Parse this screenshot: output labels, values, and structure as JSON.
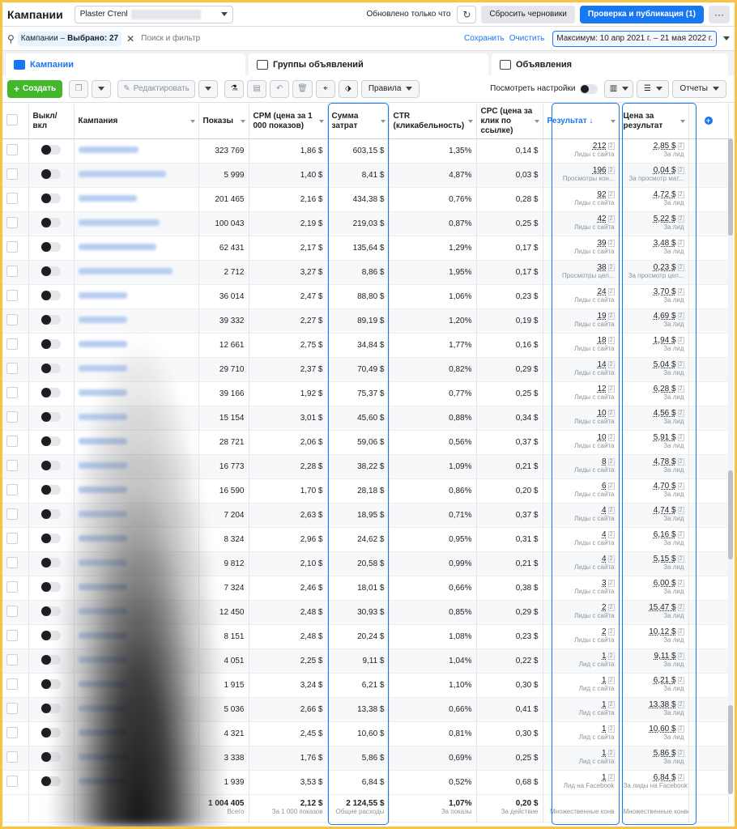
{
  "topbar": {
    "title": "Кампании",
    "account": "Plaster Стеnl",
    "updated": "Обновлено только что",
    "refresh_icon": "refresh-icon",
    "discard": "Сбросить черновики",
    "publish": "Проверка и публикация (1)",
    "more": "···"
  },
  "filter": {
    "chip_label": "Кампании",
    "chip_sep": "–",
    "chip_selected": "Выбрано: 27",
    "placeholder": "Поиск и фильтр",
    "save": "Сохранить",
    "clear": "Очистить",
    "date_range": "Максимум: 10 апр 2021 г. – 21 мая 2022 г."
  },
  "tabs": [
    {
      "label": "Кампании",
      "active": true
    },
    {
      "label": "Группы объявлений",
      "active": false
    },
    {
      "label": "Объявления",
      "active": false
    }
  ],
  "toolbar": {
    "create": "Создать",
    "edit": "Редактировать",
    "rules": "Правила",
    "view_settings": "Посмотреть настройки",
    "reports": "Отчеты"
  },
  "columns": {
    "onoff": "Выкл/вкл",
    "campaign": "Кампания",
    "impressions": "Показы",
    "cpm": "CPM (цена за 1 000 показов)",
    "spend": "Сумма затрат",
    "ctr": "CTR (кликабельность)",
    "cpc": "CPC (цена за клик по ссылке)",
    "result": "Результат ↓",
    "cost": "Цена за результат"
  },
  "rows": [
    {
      "imp": "323 769",
      "cpm": "1,86 $",
      "spend": "603,15 $",
      "ctr": "1,35%",
      "cpc": "0,14 $",
      "res": "212",
      "res_sub": "Лиды с сайта",
      "cost": "2,85 $",
      "cost_sub": "За лид",
      "bw": 74
    },
    {
      "imp": "5 999",
      "cpm": "1,40 $",
      "spend": "8,41 $",
      "ctr": "4,87%",
      "cpc": "0,03 $",
      "res": "196",
      "res_sub": "Просмотры кон...",
      "cost": "0,04 $",
      "cost_sub": "За просмотр мат...",
      "bw": 108
    },
    {
      "imp": "201 465",
      "cpm": "2,16 $",
      "spend": "434,38 $",
      "ctr": "0,76%",
      "cpc": "0,28 $",
      "res": "92",
      "res_sub": "Лиды с сайта",
      "cost": "4,72 $",
      "cost_sub": "За лид",
      "bw": 72
    },
    {
      "imp": "100 043",
      "cpm": "2,19 $",
      "spend": "219,03 $",
      "ctr": "0,87%",
      "cpc": "0,25 $",
      "res": "42",
      "res_sub": "Лиды с сайта",
      "cost": "5,22 $",
      "cost_sub": "За лид",
      "bw": 100
    },
    {
      "imp": "62 431",
      "cpm": "2,17 $",
      "spend": "135,64 $",
      "ctr": "1,29%",
      "cpc": "0,17 $",
      "res": "39",
      "res_sub": "Лиды с сайта",
      "cost": "3,48 $",
      "cost_sub": "За лид",
      "bw": 96
    },
    {
      "imp": "2 712",
      "cpm": "3,27 $",
      "spend": "8,86 $",
      "ctr": "1,95%",
      "cpc": "0,17 $",
      "res": "38",
      "res_sub": "Просмотры цел...",
      "cost": "0,23 $",
      "cost_sub": "За просмотр цел...",
      "bw": 116
    },
    {
      "imp": "36 014",
      "cpm": "2,47 $",
      "spend": "88,80 $",
      "ctr": "1,06%",
      "cpc": "0,23 $",
      "res": "24",
      "res_sub": "Лиды с сайта",
      "cost": "3,70 $",
      "cost_sub": "За лид",
      "bw": 60
    },
    {
      "imp": "39 332",
      "cpm": "2,27 $",
      "spend": "89,19 $",
      "ctr": "1,20%",
      "cpc": "0,19 $",
      "res": "19",
      "res_sub": "Лиды с сайта",
      "cost": "4,69 $",
      "cost_sub": "За лид",
      "bw": 60
    },
    {
      "imp": "12 661",
      "cpm": "2,75 $",
      "spend": "34,84 $",
      "ctr": "1,77%",
      "cpc": "0,16 $",
      "res": "18",
      "res_sub": "Лиды с сайта",
      "cost": "1,94 $",
      "cost_sub": "За лид",
      "bw": 60
    },
    {
      "imp": "29 710",
      "cpm": "2,37 $",
      "spend": "70,49 $",
      "ctr": "0,82%",
      "cpc": "0,29 $",
      "res": "14",
      "res_sub": "Лиды с сайта",
      "cost": "5,04 $",
      "cost_sub": "За лид",
      "bw": 60
    },
    {
      "imp": "39 166",
      "cpm": "1,92 $",
      "spend": "75,37 $",
      "ctr": "0,77%",
      "cpc": "0,25 $",
      "res": "12",
      "res_sub": "Лиды с сайта",
      "cost": "6,28 $",
      "cost_sub": "За лид",
      "bw": 60
    },
    {
      "imp": "15 154",
      "cpm": "3,01 $",
      "spend": "45,60 $",
      "ctr": "0,88%",
      "cpc": "0,34 $",
      "res": "10",
      "res_sub": "Лиды с сайта",
      "cost": "4,56 $",
      "cost_sub": "За лид",
      "bw": 60
    },
    {
      "imp": "28 721",
      "cpm": "2,06 $",
      "spend": "59,06 $",
      "ctr": "0,56%",
      "cpc": "0,37 $",
      "res": "10",
      "res_sub": "Лиды с сайта",
      "cost": "5,91 $",
      "cost_sub": "За лид",
      "bw": 60
    },
    {
      "imp": "16 773",
      "cpm": "2,28 $",
      "spend": "38,22 $",
      "ctr": "1,09%",
      "cpc": "0,21 $",
      "res": "8",
      "res_sub": "Лиды с сайта",
      "cost": "4,78 $",
      "cost_sub": "За лид",
      "bw": 60
    },
    {
      "imp": "16 590",
      "cpm": "1,70 $",
      "spend": "28,18 $",
      "ctr": "0,86%",
      "cpc": "0,20 $",
      "res": "6",
      "res_sub": "Лиды с сайта",
      "cost": "4,70 $",
      "cost_sub": "За лид",
      "bw": 60
    },
    {
      "imp": "7 204",
      "cpm": "2,63 $",
      "spend": "18,95 $",
      "ctr": "0,71%",
      "cpc": "0,37 $",
      "res": "4",
      "res_sub": "Лиды с сайта",
      "cost": "4,74 $",
      "cost_sub": "За лид",
      "bw": 60
    },
    {
      "imp": "8 324",
      "cpm": "2,96 $",
      "spend": "24,62 $",
      "ctr": "0,95%",
      "cpc": "0,31 $",
      "res": "4",
      "res_sub": "Лиды с сайта",
      "cost": "6,16 $",
      "cost_sub": "За лид",
      "bw": 60
    },
    {
      "imp": "9 812",
      "cpm": "2,10 $",
      "spend": "20,58 $",
      "ctr": "0,99%",
      "cpc": "0,21 $",
      "res": "4",
      "res_sub": "Лиды с сайта",
      "cost": "5,15 $",
      "cost_sub": "За лид",
      "bw": 60
    },
    {
      "imp": "7 324",
      "cpm": "2,46 $",
      "spend": "18,01 $",
      "ctr": "0,66%",
      "cpc": "0,38 $",
      "res": "3",
      "res_sub": "Лиды с сайта",
      "cost": "6,00 $",
      "cost_sub": "За лид",
      "bw": 60
    },
    {
      "imp": "12 450",
      "cpm": "2,48 $",
      "spend": "30,93 $",
      "ctr": "0,85%",
      "cpc": "0,29 $",
      "res": "2",
      "res_sub": "Лиды с сайта",
      "cost": "15,47 $",
      "cost_sub": "За лид",
      "bw": 60
    },
    {
      "imp": "8 151",
      "cpm": "2,48 $",
      "spend": "20,24 $",
      "ctr": "1,08%",
      "cpc": "0,23 $",
      "res": "2",
      "res_sub": "Лиды с сайта",
      "cost": "10,12 $",
      "cost_sub": "За лид",
      "bw": 60
    },
    {
      "imp": "4 051",
      "cpm": "2,25 $",
      "spend": "9,11 $",
      "ctr": "1,04%",
      "cpc": "0,22 $",
      "res": "1",
      "res_sub": "Лид с сайта",
      "cost": "9,11 $",
      "cost_sub": "За лид",
      "bw": 60
    },
    {
      "imp": "1 915",
      "cpm": "3,24 $",
      "spend": "6,21 $",
      "ctr": "1,10%",
      "cpc": "0,30 $",
      "res": "1",
      "res_sub": "Лид с сайта",
      "cost": "6,21 $",
      "cost_sub": "За лид",
      "bw": 60
    },
    {
      "imp": "5 036",
      "cpm": "2,66 $",
      "spend": "13,38 $",
      "ctr": "0,66%",
      "cpc": "0,41 $",
      "res": "1",
      "res_sub": "Лид с сайта",
      "cost": "13,38 $",
      "cost_sub": "За лид",
      "bw": 60
    },
    {
      "imp": "4 321",
      "cpm": "2,45 $",
      "spend": "10,60 $",
      "ctr": "0,81%",
      "cpc": "0,30 $",
      "res": "1",
      "res_sub": "Лид с сайта",
      "cost": "10,60 $",
      "cost_sub": "За лид",
      "bw": 60
    },
    {
      "imp": "3 338",
      "cpm": "1,76 $",
      "spend": "5,86 $",
      "ctr": "0,69%",
      "cpc": "0,25 $",
      "res": "1",
      "res_sub": "Лид с сайта",
      "cost": "5,86 $",
      "cost_sub": "За лид",
      "bw": 60
    },
    {
      "imp": "1 939",
      "cpm": "3,53 $",
      "spend": "6,84 $",
      "ctr": "0,52%",
      "cpc": "0,68 $",
      "res": "1",
      "res_sub": "Лид на Facebook",
      "cost": "6,84 $",
      "cost_sub": "За лиды на Facebook",
      "bw": 60
    }
  ],
  "totals": {
    "imp": "1 004 405",
    "imp_sub": "Всего",
    "cpm": "2,12 $",
    "cpm_sub": "За 1 000 показов",
    "spend": "2 124,55 $",
    "spend_sub": "Общие расходы",
    "ctr": "1,07%",
    "ctr_sub": "За показы",
    "cpc": "0,20 $",
    "cpc_sub": "За действие",
    "res_sub": "Множественные конв",
    "cost_sub": "Множественные конвер"
  },
  "colors": {
    "accent": "#1877f2",
    "green": "#42b72a",
    "frame": "#f6c343"
  }
}
